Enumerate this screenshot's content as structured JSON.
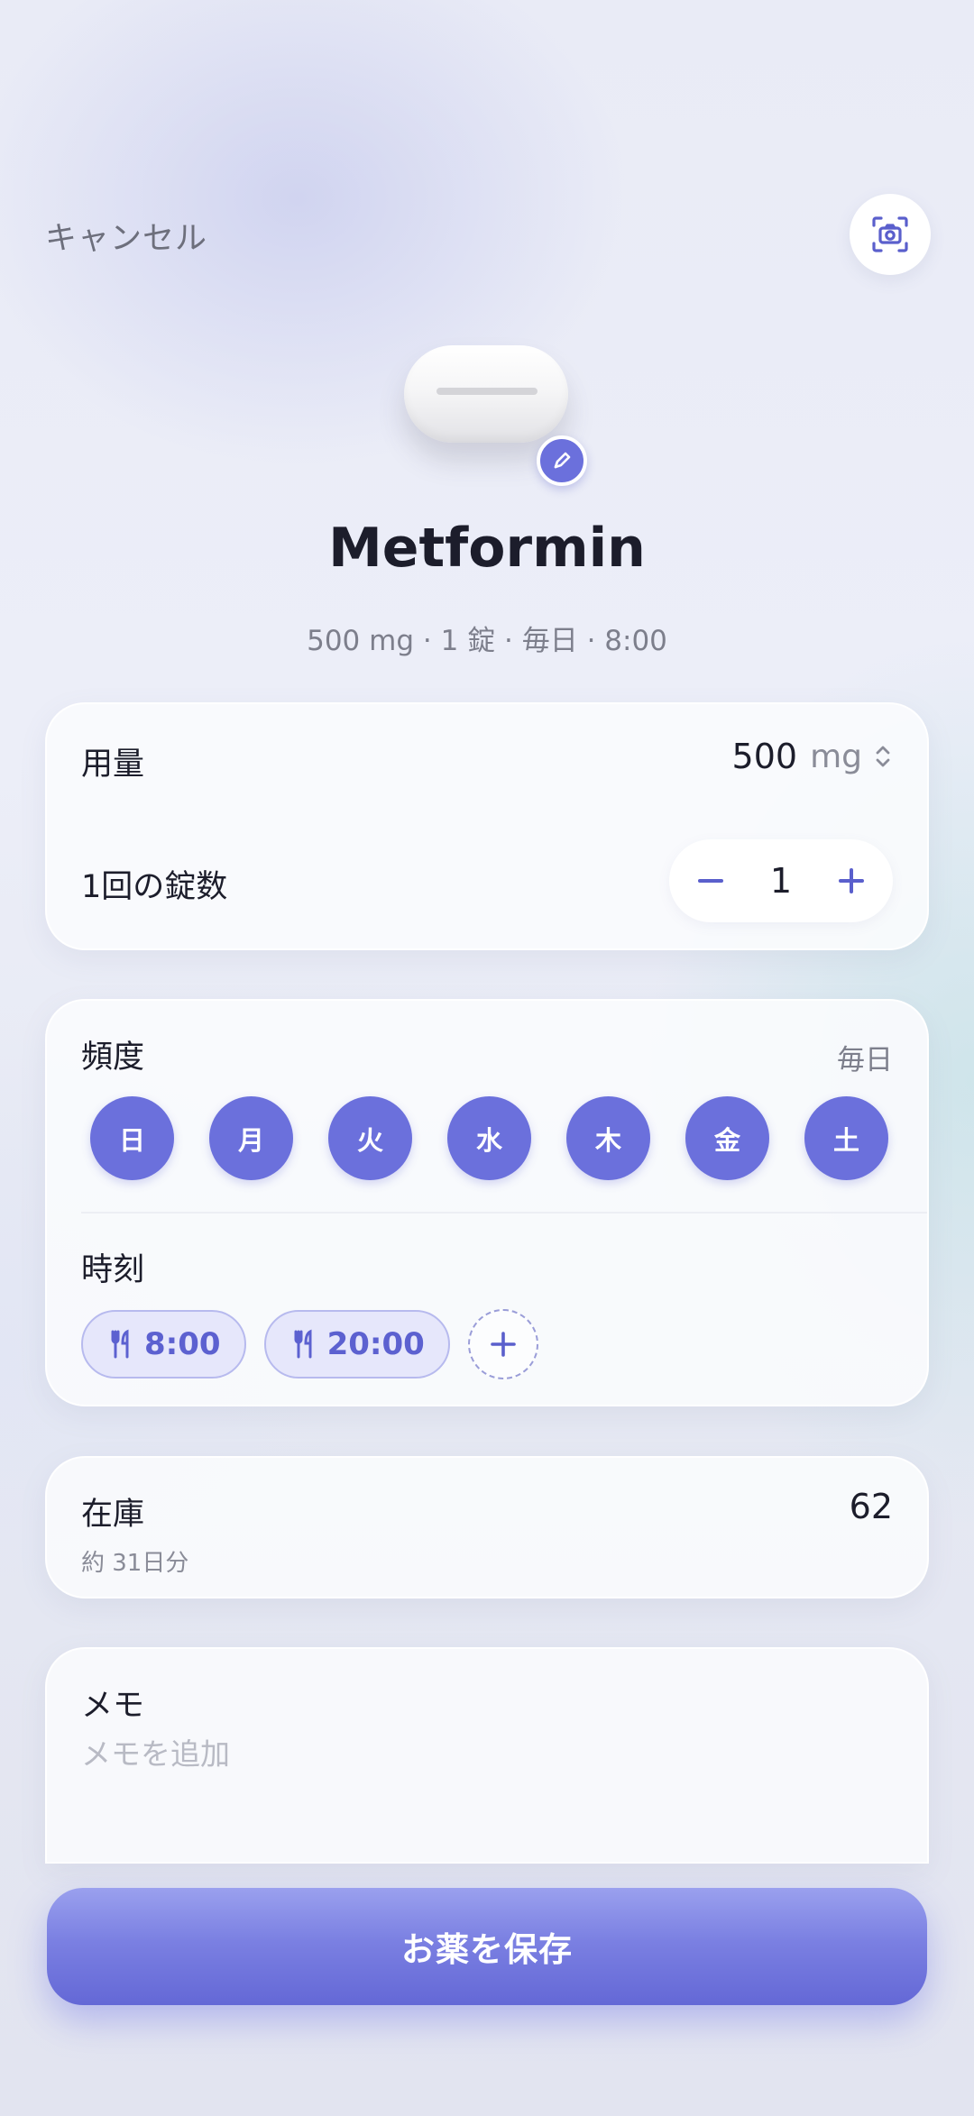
{
  "header": {
    "cancel_label": "キャンセル",
    "camera_icon": "camera-scan-icon"
  },
  "medication": {
    "name": "Metformin",
    "summary": "500 mg · 1 錠 · 毎日 · 8:00",
    "edit_icon": "pencil-icon"
  },
  "dose": {
    "label": "用量",
    "value": "500",
    "unit": "mg",
    "tablets_label": "1回の錠数",
    "tablets_value": "1"
  },
  "frequency": {
    "label": "頻度",
    "value": "毎日",
    "days": [
      {
        "label": "日",
        "selected": true
      },
      {
        "label": "月",
        "selected": true
      },
      {
        "label": "火",
        "selected": true
      },
      {
        "label": "水",
        "selected": true
      },
      {
        "label": "木",
        "selected": true
      },
      {
        "label": "金",
        "selected": true
      },
      {
        "label": "土",
        "selected": true
      }
    ]
  },
  "times": {
    "label": "時刻",
    "items": [
      {
        "time": "8:00",
        "icon": "fork-knife-icon"
      },
      {
        "time": "20:00",
        "icon": "fork-knife-icon"
      }
    ]
  },
  "stock": {
    "label": "在庫",
    "count": "62",
    "remaining_text": "約 31日分"
  },
  "memo": {
    "label": "メモ",
    "placeholder": "メモを追加"
  },
  "save_button": {
    "label": "お薬を保存"
  },
  "colors": {
    "accent": "#6b70dc",
    "chip_bg": "#e6e7fb",
    "text_primary": "#1c1d2b",
    "text_secondary": "#7d7f8c"
  }
}
